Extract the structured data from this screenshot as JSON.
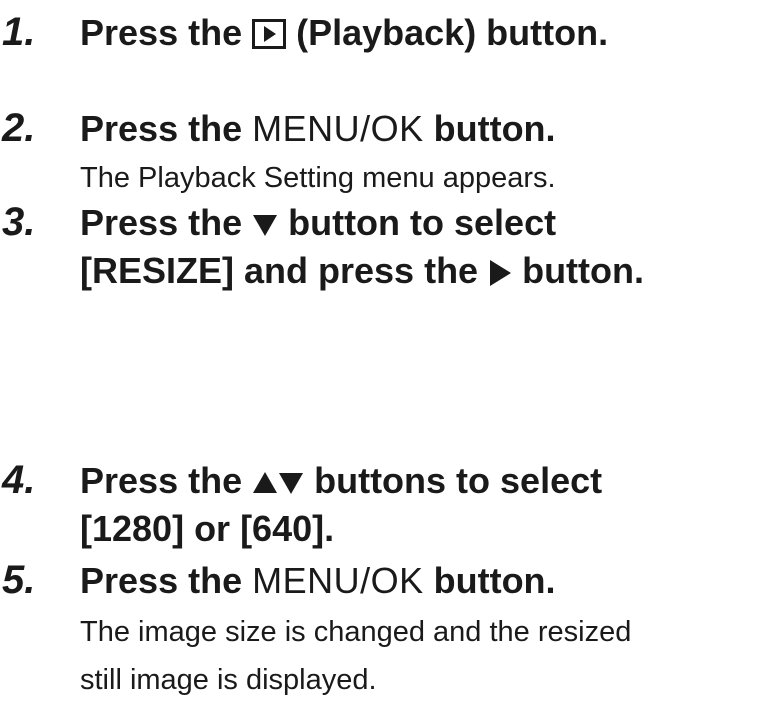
{
  "steps": [
    {
      "number": "1.",
      "line1_pre": "Press the ",
      "line1_post": " (Playback) button."
    },
    {
      "number": "2.",
      "line1_pre": "Press the ",
      "menu_label": "MENU/OK",
      "line1_post": " button.",
      "description": "The Playback Setting menu appears."
    },
    {
      "number": "3.",
      "line1_pre": "Press the ",
      "line1_post": " button to select",
      "line2_pre": "[RESIZE] and press the ",
      "line2_post": " button."
    },
    {
      "number": "4.",
      "line1_pre": "Press the ",
      "line1_post": " buttons to select",
      "line2": "[1280] or [640]."
    },
    {
      "number": "5.",
      "line1_pre": "Press the ",
      "menu_label": "MENU/OK",
      "line1_post": " button.",
      "description_line1": "The image size is changed and the resized",
      "description_line2": "still image is displayed."
    }
  ],
  "icons": {
    "playback": "playback-icon",
    "down": "down-arrow-icon",
    "right": "right-arrow-icon",
    "up": "up-arrow-icon"
  },
  "colors": {
    "text": "#1a1a1a",
    "background": "#ffffff"
  }
}
